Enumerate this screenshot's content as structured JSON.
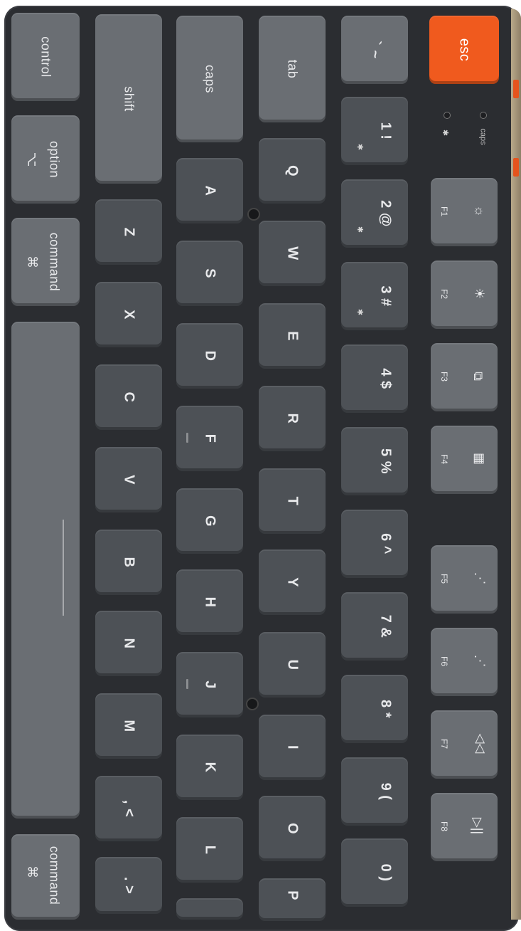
{
  "keyboard": {
    "colors": {
      "accent": "#f05a1e",
      "case": "#2b2d31",
      "key_dark": "#4d5156",
      "key_light": "#6a6e73",
      "legend": "#e8e9eb"
    },
    "indicators": {
      "bt_icon": "bluetooth-icon",
      "caps_label": "caps"
    },
    "keys": {
      "esc": "esc",
      "grave": "` ~",
      "n1": "1 !",
      "n2": "2 @",
      "n3": "3 #",
      "n4": "4 $",
      "n5": "5 %",
      "n6": "6 ^",
      "n7": "7 &",
      "n8": "8 *",
      "n9": "9 (",
      "n0": "0 )",
      "tab": "tab",
      "q": "Q",
      "w": "W",
      "e": "E",
      "r": "R",
      "t": "T",
      "y": "Y",
      "u": "U",
      "i": "I",
      "o": "O",
      "p": "P",
      "caps": "caps",
      "a": "A",
      "s": "S",
      "d": "D",
      "f": "F",
      "g": "G",
      "h": "H",
      "j": "J",
      "k": "K",
      "l": "L",
      "shift": "shift",
      "z": "Z",
      "x": "X",
      "c": "C",
      "v": "V",
      "b": "B",
      "n": "N",
      "m": "M",
      "comma": ", <",
      "period": ". >",
      "control": "control",
      "option": "option",
      "option_sym": "⌥",
      "command": "command",
      "command_sym": "⌘",
      "command_r": "command",
      "command_r_sym": "⌘",
      "f1": "F1",
      "f2": "F2",
      "f3": "F3",
      "f4": "F4",
      "f5": "F5",
      "f6": "F6",
      "f7": "F7",
      "f8": "F8"
    },
    "fn_icons": {
      "f1": "☼",
      "f2": "☀",
      "f3": "⧉",
      "f4": "▦",
      "f5": "⋰",
      "f6": "⋰",
      "f7": "◁◁",
      "f8": "▷||"
    }
  }
}
